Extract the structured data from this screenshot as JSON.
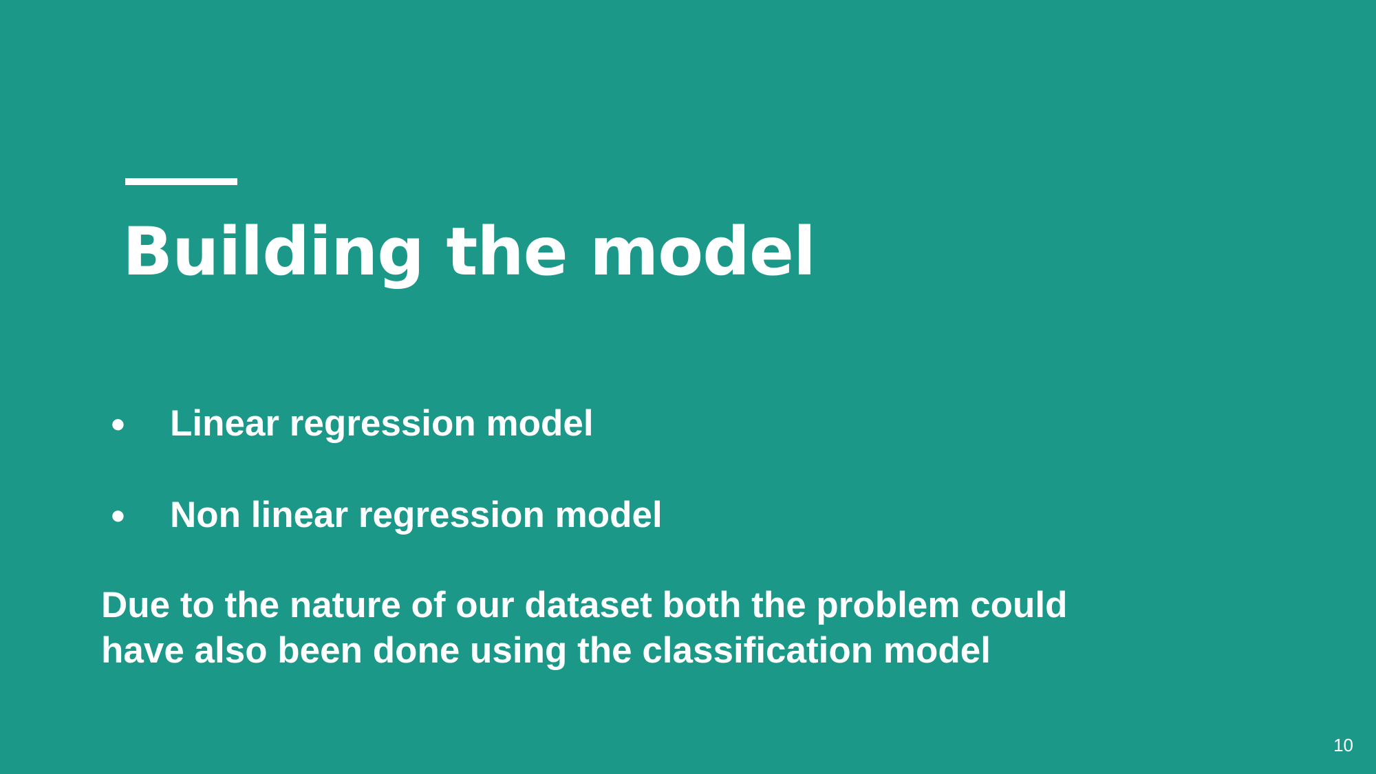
{
  "slide": {
    "title": "Building the model",
    "bullets": [
      {
        "marker": "●",
        "text": "Linear regression model"
      },
      {
        "marker": "●",
        "text": "Non linear regression model"
      }
    ],
    "note_lines": [
      "Due to the nature of our dataset both the problem could",
      "have also been done using the classification model"
    ],
    "page_number": "10"
  },
  "colors": {
    "background": "#1c9889",
    "text": "#ffffff"
  }
}
